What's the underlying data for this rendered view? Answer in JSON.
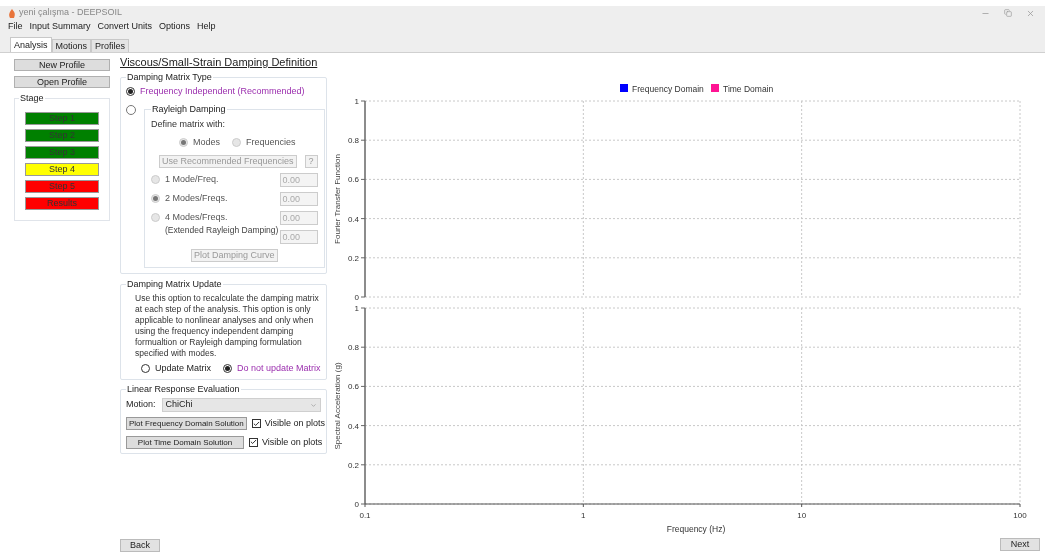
{
  "window": {
    "title": "yeni çalışma - DEEPSOIL"
  },
  "menu": [
    "File",
    "Input Summary",
    "Convert Units",
    "Options",
    "Help"
  ],
  "tabs": [
    {
      "label": "Analysis",
      "selected": true
    },
    {
      "label": "Motions",
      "selected": false
    },
    {
      "label": "Profiles",
      "selected": false
    }
  ],
  "sidebar": {
    "buttons": [
      "New Profile",
      "Open Profile"
    ],
    "stage": {
      "title": "Stage",
      "steps": [
        {
          "label": "Step 1",
          "color": "#008000"
        },
        {
          "label": "Step 2",
          "color": "#008000"
        },
        {
          "label": "Step 3",
          "color": "#008000"
        },
        {
          "label": "Step 4",
          "color": "#ffff00"
        },
        {
          "label": "Step 5",
          "color": "#ff0000"
        },
        {
          "label": "Results",
          "color": "#ff0000"
        }
      ]
    }
  },
  "page_title": "Viscous/Small-Strain Damping Definition",
  "damping_matrix_type": {
    "title": "Damping Matrix Type",
    "frequency_independent": {
      "label": "Frequency Independent (Recommended)",
      "selected": true
    },
    "rayleigh": {
      "selected": false,
      "disabled": true,
      "title": "Rayleigh Damping",
      "define_label": "Define matrix with:",
      "define_options": [
        {
          "label": "Modes",
          "selected": true
        },
        {
          "label": "Frequencies",
          "selected": false
        }
      ],
      "recommend_button": "Use Recommended Frequencies",
      "help_button": "?",
      "modes": [
        {
          "label": "1 Mode/Freq.",
          "selected": false,
          "fields": [
            "0.00"
          ]
        },
        {
          "label": "2 Modes/Freqs.",
          "selected": true,
          "fields": [
            "0.00"
          ]
        },
        {
          "label": "4 Modes/Freqs.",
          "sublabel": "(Extended Rayleigh Damping)",
          "selected": false,
          "fields": [
            "0.00",
            "0.00"
          ]
        }
      ],
      "plot_button": "Plot Damping Curve"
    }
  },
  "damping_matrix_update": {
    "title": "Damping Matrix Update",
    "description": "Use this option to recalculate the damping matrix at each step of the analysis. This option is only applicable to nonlinear analyses and only when using the frequency independent damping formualtion or Rayleigh damping formulation specified with modes.",
    "options": [
      {
        "label": "Update Matrix",
        "selected": false
      },
      {
        "label": "Do not update Matrix",
        "selected": true
      }
    ]
  },
  "linear_response": {
    "title": "Linear Response Evaluation",
    "motion_label": "Motion:",
    "motion_value": "ChiChi",
    "plots": [
      {
        "button": "Plot Frequency Domain Solution",
        "checkbox_label": "Visible on plots",
        "checked": true
      },
      {
        "button": "Plot Time Domain Solution",
        "checkbox_label": "Visible on plots",
        "checked": true
      }
    ]
  },
  "charts": [
    {
      "chart_data": {
        "type": "line",
        "grid": true,
        "ylabel": "Fourier Transfer Function",
        "categories": [
          null,
          null,
          null,
          null
        ],
        "ylim": [
          0,
          1
        ],
        "yticks": [
          0,
          0.2,
          0.4,
          0.6,
          0.8,
          1
        ],
        "series": [
          {
            "name": "Frequency Domain",
            "color": "#0000ff",
            "values": [
              null,
              null,
              null,
              null
            ]
          },
          {
            "name": "Time Domain",
            "color": "#ff1493",
            "values": [
              null,
              null,
              null,
              null
            ]
          }
        ]
      }
    },
    {
      "chart_data": {
        "type": "line",
        "grid": true,
        "xlabel": "Frequency (Hz)",
        "ylabel": "Spectral Acceleration (g)",
        "categories": [
          "0.1",
          "1",
          "10",
          "100"
        ],
        "ylim": [
          0,
          1
        ],
        "yticks": [
          0,
          0.2,
          0.4,
          0.6,
          0.8,
          1
        ]
      }
    }
  ],
  "back_button": "Back",
  "next_button": "Next"
}
